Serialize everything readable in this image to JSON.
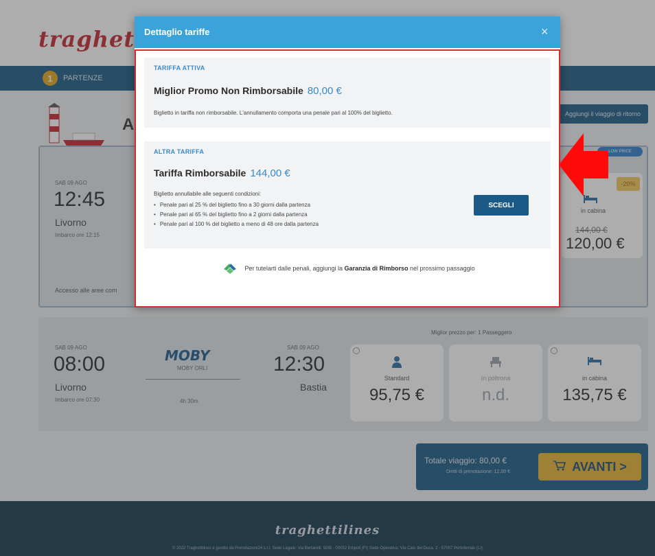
{
  "header": {
    "logo_text": "traghet",
    "nav_badge": "1",
    "nav_label": "PARTENZE",
    "hero_letter": "A",
    "return_label": "Aggiungi il viaggio di ritorno"
  },
  "trip1": {
    "date": "SAB 09 AGO",
    "time": "12:45",
    "city": "Livorno",
    "boarding": "Imbarco ore 12:15",
    "access": "Accesso alle aree com",
    "tag": "LOW PRICE",
    "discount": "-20%",
    "cabin_label": "in cabina",
    "old_price": "144,00 €",
    "price": "120,00 €"
  },
  "trip2": {
    "best_price_label": "Miglior prezzo per: 1 Passeggero",
    "date": "SAB 09 AGO",
    "time": "08:00",
    "city": "Livorno",
    "boarding": "Imbarco ore 07:30",
    "brand": "MOBY",
    "brand_sub": "MOBY ORLI",
    "duration": "4h 30m",
    "arrival_date": "SAB 09 AGO",
    "arrival_time": "12:30",
    "arrival_city": "Bastia",
    "seats": [
      {
        "label": "Standard",
        "price": "95,75 €",
        "icon": "person-icon"
      },
      {
        "label": "In poltrona",
        "price": "n.d.",
        "icon": "armchair-icon"
      },
      {
        "label": "in cabina",
        "price": "135,75 €",
        "icon": "bed-icon"
      }
    ]
  },
  "summary": {
    "total_label": "Totale viaggio: 80,00 €",
    "total_sub": "Diritti di prenotazione: 12,00 €",
    "next_label": "AVANTI >"
  },
  "footer": {
    "logo": "traghettilines",
    "copyright": "© 2022 Traghettilines è gestito da Prenotazioni24 s.r.l. Sede Legale: Via Bertarelli, 50/B - 00052 Empoli (FI) Sede Operativa: Via Caio del Duca, 2 - 57007 Portoferraio (LI)"
  },
  "modal": {
    "title": "Dettaglio tariffe",
    "close": "×",
    "active": {
      "heading": "TARIFFA ATTIVA",
      "name": "Miglior Promo Non Rimborsabile",
      "price": "80,00 €",
      "description": "Biglietto in tariffa non rimborsabile. L'annullamento comporta una penale pari al 100% del biglietto."
    },
    "other": {
      "heading": "ALTRA TARIFFA",
      "name": "Tariffa Rimborsabile",
      "price": "144,00 €",
      "conditions_title": "Biglietto annullabile alle seguenti condizioni:",
      "conditions": [
        "Penale pari al 25 % del biglietto fino a 30 giorni dalla partenza",
        "Penale pari al 65 % del biglietto fino a 2 giorni dalla partenza",
        "Penale pari al 100 % del biglietto a meno di 48 ore dalla partenza"
      ],
      "choose_label": "SCEGLI"
    },
    "guarantee": {
      "prefix": "Per tutelarti dalle penali, aggiungi la",
      "bold": "Garanzia di Rimborso",
      "suffix": "nel prossimo passaggio"
    }
  },
  "colors": {
    "primary": "#1b5a86",
    "modal_header": "#3aa3d9",
    "accent_blue": "#3a88c4",
    "highlight_red": "#d22c2c",
    "next_yellow": "#e7b433"
  }
}
